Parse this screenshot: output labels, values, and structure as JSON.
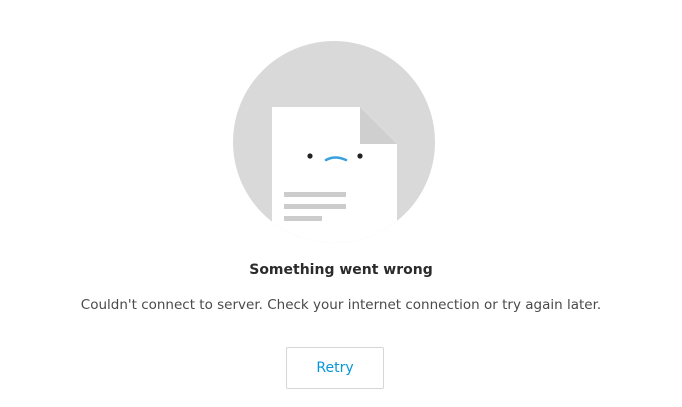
{
  "error": {
    "title": "Something went wrong",
    "message": "Couldn't connect to server. Check your internet connection or try again later.",
    "retry_label": "Retry",
    "illustration_icon": "sad-document-icon"
  },
  "colors": {
    "accent": "#0696d7",
    "circle": "#d9d9d9",
    "document": "#ffffff",
    "document_fold": "#cfcfcf",
    "text_lines": "#cccccc",
    "title": "#2b2b2b",
    "message": "#4a4a4a",
    "button_border": "#d6d6d6"
  }
}
